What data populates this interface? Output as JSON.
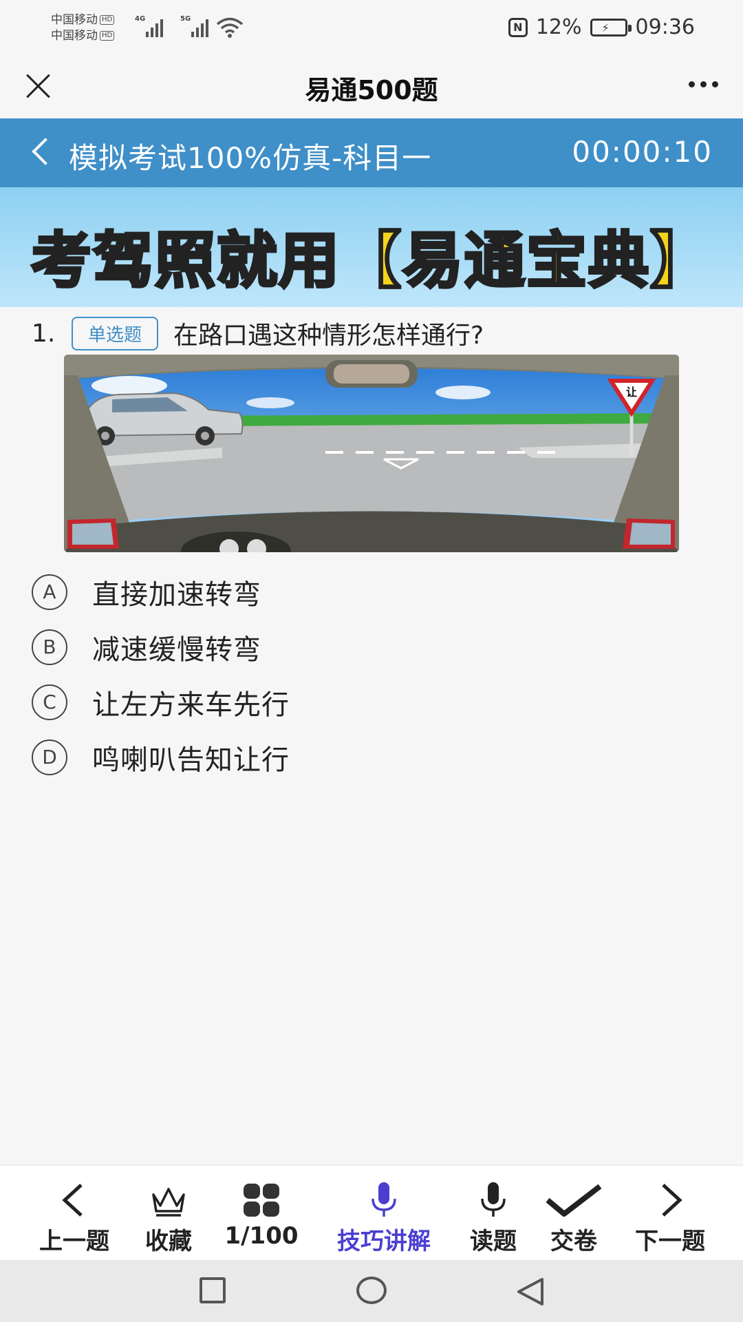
{
  "status_bar": {
    "carrier1": "中国移动",
    "carrier2": "中国移动",
    "hd": "HD",
    "net1": "4G",
    "net2": "5G",
    "battery": "12%",
    "time": "09:36"
  },
  "topbar": {
    "title": "易通500题"
  },
  "exam": {
    "title": "模拟考试100%仿真-科目一",
    "timer": "00:00:10"
  },
  "banner": {
    "text": "考驾照就用【易通宝典】"
  },
  "question": {
    "number": "1.",
    "type": "单选题",
    "text": "在路口遇这种情形怎样通行?",
    "image_sign_text": "让"
  },
  "options": [
    {
      "letter": "A",
      "text": "直接加速转弯"
    },
    {
      "letter": "B",
      "text": "减速缓慢转弯"
    },
    {
      "letter": "C",
      "text": "让左方来车先行"
    },
    {
      "letter": "D",
      "text": "鸣喇叭告知让行"
    }
  ],
  "toolbar": [
    {
      "icon": "chevron-left-icon",
      "label": "上一题"
    },
    {
      "icon": "crown-icon",
      "label": "收藏"
    },
    {
      "icon": "grid-icon",
      "label": "1/100"
    },
    {
      "icon": "microphone-icon",
      "label": "技巧讲解",
      "active": true
    },
    {
      "icon": "microphone-icon",
      "label": "读题"
    },
    {
      "icon": "checkmark-icon",
      "label": "交卷"
    },
    {
      "icon": "chevron-right-icon",
      "label": "下一题"
    }
  ],
  "colors": {
    "header_blue": "#3f8fc8",
    "active_purple": "#4a3fd0",
    "banner_yellow": "#f5d31c"
  }
}
